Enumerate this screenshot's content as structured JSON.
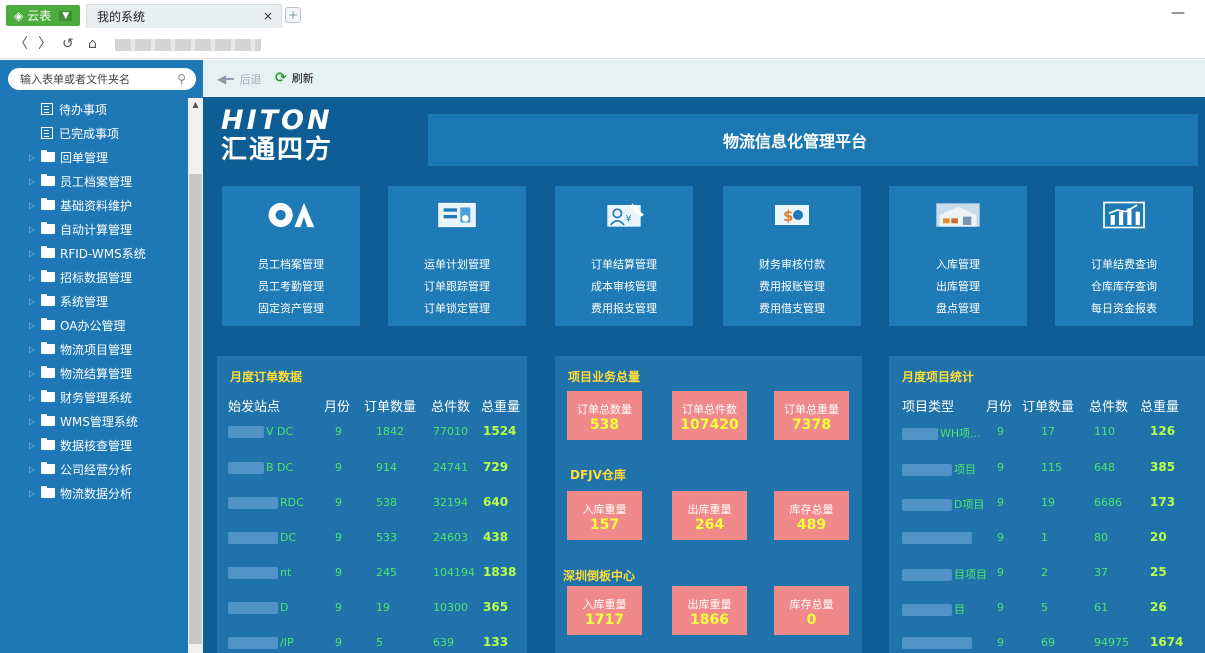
{
  "browser": {
    "app_tab_label": "云表",
    "doc_tab_label": "我的系统",
    "close_glyph": "×",
    "new_tab_glyph": "+",
    "minimize_glyph": "—"
  },
  "sidebar": {
    "search_placeholder": "输入表单或者文件夹名",
    "items": [
      {
        "label": "待办事项",
        "kind": "list"
      },
      {
        "label": "已完成事项",
        "kind": "list"
      },
      {
        "label": "回单管理",
        "kind": "folder"
      },
      {
        "label": "员工档案管理",
        "kind": "folder"
      },
      {
        "label": "基础资料维护",
        "kind": "folder"
      },
      {
        "label": "自动计算管理",
        "kind": "folder"
      },
      {
        "label": "RFID-WMS系统",
        "kind": "folder"
      },
      {
        "label": "招标数据管理",
        "kind": "folder"
      },
      {
        "label": "系统管理",
        "kind": "folder"
      },
      {
        "label": "OA办公管理",
        "kind": "folder"
      },
      {
        "label": "物流项目管理",
        "kind": "folder"
      },
      {
        "label": "物流结算管理",
        "kind": "folder"
      },
      {
        "label": "财务管理系统",
        "kind": "folder"
      },
      {
        "label": "WMS管理系统",
        "kind": "folder"
      },
      {
        "label": "数据核查管理",
        "kind": "folder"
      },
      {
        "label": "公司经营分析",
        "kind": "folder"
      },
      {
        "label": "物流数据分析",
        "kind": "folder"
      }
    ]
  },
  "toolbar": {
    "back_label": "后退",
    "refresh_label": "刷新"
  },
  "header": {
    "brand_en": "HITON",
    "brand_cn": "汇通四方",
    "title": "物流信息化管理平台"
  },
  "tiles": [
    {
      "icon": "oa-logo-icon",
      "links": [
        "员工档案管理",
        "员工考勤管理",
        "固定资产管理"
      ]
    },
    {
      "icon": "transport-plan-icon",
      "links": [
        "运单计划管理",
        "订单跟踪管理",
        "订单锁定管理"
      ]
    },
    {
      "icon": "settlement-doc-icon",
      "links": [
        "订单结算管理",
        "成本审核管理",
        "费用报支管理"
      ]
    },
    {
      "icon": "money-icon",
      "links": [
        "财务审核付款",
        "费用报账管理",
        "费用借支管理"
      ]
    },
    {
      "icon": "warehouse-icon",
      "links": [
        "入库管理",
        "出库管理",
        "盘点管理"
      ]
    },
    {
      "icon": "chart-report-icon",
      "links": [
        "订单结费查询",
        "仓库库存查询",
        "每日资金报表"
      ]
    }
  ],
  "monthly_orders": {
    "title": "月度订单数据",
    "headers": [
      "始发站点",
      "月份",
      "订单数量",
      "总件数",
      "总重量"
    ],
    "rows": [
      {
        "site": "V      DC",
        "month": "9",
        "orders": "1842",
        "pieces": "77010",
        "weight": "1524"
      },
      {
        "site": "B      DC",
        "month": "9",
        "orders": "914",
        "pieces": "24741",
        "weight": "729"
      },
      {
        "site": "RDC",
        "month": "9",
        "orders": "538",
        "pieces": "32194",
        "weight": "640"
      },
      {
        "site": "DC",
        "month": "9",
        "orders": "533",
        "pieces": "24603",
        "weight": "438"
      },
      {
        "site": "nt",
        "month": "9",
        "orders": "245",
        "pieces": "104194",
        "weight": "1838"
      },
      {
        "site": "D",
        "month": "9",
        "orders": "19",
        "pieces": "10300",
        "weight": "365"
      },
      {
        "site": "/IP",
        "month": "9",
        "orders": "5",
        "pieces": "639",
        "weight": "133"
      }
    ]
  },
  "project_totals": {
    "title": "项目业务总量",
    "top": [
      {
        "label": "订单总数量",
        "value": "538"
      },
      {
        "label": "订单总件数",
        "value": "107420"
      },
      {
        "label": "订单总重量",
        "value": "7378"
      }
    ],
    "dfjv_title": "DFJV仓库",
    "dfjv": [
      {
        "label": "入库重量",
        "value": "157"
      },
      {
        "label": "出库重量",
        "value": "264"
      },
      {
        "label": "库存总量",
        "value": "489"
      }
    ],
    "sz_title": "深圳倒板中心",
    "sz": [
      {
        "label": "入库重量",
        "value": "1717"
      },
      {
        "label": "出库重量",
        "value": "1866"
      },
      {
        "label": "库存总量",
        "value": "0"
      }
    ]
  },
  "monthly_projects": {
    "title": "月度项目统计",
    "headers": [
      "项目类型",
      "月份",
      "订单数量",
      "总件数",
      "总重量"
    ],
    "rows": [
      {
        "type": "WH项...",
        "month": "9",
        "orders": "17",
        "pieces": "110",
        "weight": "126"
      },
      {
        "type": "项目",
        "month": "9",
        "orders": "115",
        "pieces": "648",
        "weight": "385"
      },
      {
        "type": "D项目",
        "month": "9",
        "orders": "19",
        "pieces": "6686",
        "weight": "173"
      },
      {
        "type": "",
        "month": "9",
        "orders": "1",
        "pieces": "80",
        "weight": "20"
      },
      {
        "type": "目项目",
        "month": "9",
        "orders": "2",
        "pieces": "37",
        "weight": "25"
      },
      {
        "type": "目",
        "month": "9",
        "orders": "5",
        "pieces": "61",
        "weight": "26"
      },
      {
        "type": "",
        "month": "9",
        "orders": "69",
        "pieces": "94975",
        "weight": "1674"
      }
    ]
  }
}
